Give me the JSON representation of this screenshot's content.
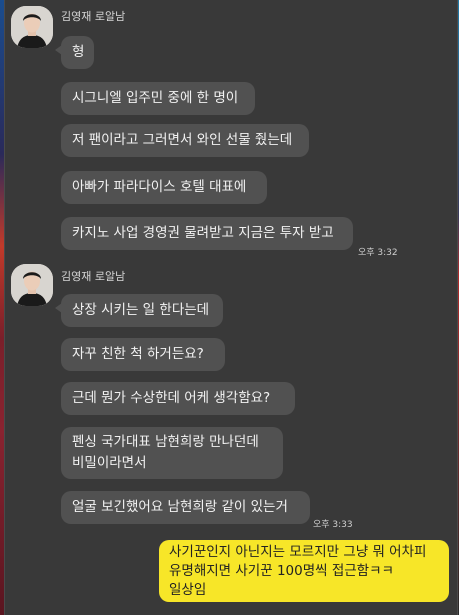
{
  "colors": {
    "background": "#393939",
    "incoming_bubble": "#515151",
    "outgoing_bubble": "#f7e628"
  },
  "group1": {
    "sender": "김영재 로알남",
    "messages": [
      "형",
      "시그니엘 입주민 중에 한 명이",
      "저 팬이라고 그러면서 와인 선물 줬는데",
      "아빠가 파라다이스 호텔 대표에",
      "카지노 사업 경영권 물려받고 지금은 투자 받고"
    ],
    "time": "오후 3:32"
  },
  "group2": {
    "sender": "김영재 로알남",
    "messages": [
      "상장 시키는 일 한다는데",
      "자꾸 친한 척 하거든요?",
      "근데 뭔가 수상한데 어케 생각함요?",
      [
        "펜싱 국가대표 남현희랑 만나던데",
        "비밀이라면서"
      ],
      "얼굴 보긴했어요 남현희랑 같이 있는거"
    ],
    "time": "오후 3:33"
  },
  "my_message": {
    "lines": [
      "사기꾼인지 아닌지는 모르지만 그냥 뭐 어차피",
      "유명해지면 사기꾼 100명씩 접근함ㅋㅋ",
      "일상임"
    ]
  }
}
